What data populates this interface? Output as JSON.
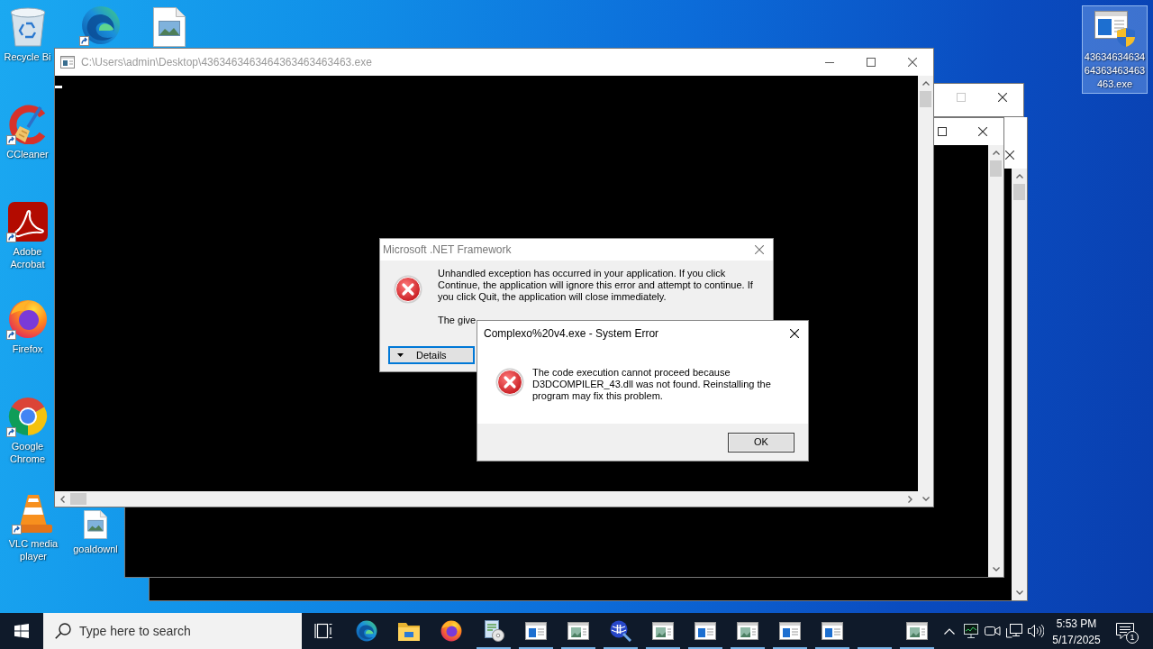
{
  "desktop_icons": [
    {
      "kind": "recycle-bin",
      "label": "Recycle Bi",
      "shortcut": false,
      "selected": false
    },
    {
      "kind": "edge",
      "shortcut": true,
      "selected": false
    },
    {
      "kind": "image-file",
      "shortcut": false,
      "selected": false
    },
    {
      "kind": "ccleaner",
      "label": "CCleaner",
      "shortcut": true,
      "selected": false
    },
    {
      "kind": "acrobat",
      "label": "Adobe Acrobat",
      "shortcut": true,
      "selected": false
    },
    {
      "kind": "firefox",
      "label": "Firefox",
      "shortcut": true,
      "selected": false
    },
    {
      "kind": "chrome",
      "label": "Google Chrome",
      "shortcut": true,
      "selected": false
    },
    {
      "kind": "vlc",
      "label": "VLC media player",
      "shortcut": true,
      "selected": false
    },
    {
      "kind": "image-file",
      "label": "goaldownl",
      "shortcut": false,
      "selected": false
    },
    {
      "kind": "program",
      "label": "4363463463464363463463463.exe",
      "shortcut": false,
      "selected": true
    }
  ],
  "background_windows": [
    {
      "kind": "blank",
      "maximize_disabled": true
    },
    {
      "kind": "console",
      "maximize_disabled": false
    },
    {
      "kind": "console"
    }
  ],
  "console_window": {
    "title": "C:\\Users\\admin\\Desktop\\4363463463464363463463463.exe",
    "active": false
  },
  "net_dialog": {
    "title": "Microsoft .NET Framework",
    "active": false,
    "message": "Unhandled exception has occurred in your application. If you click Continue, the application will ignore this error and attempt to continue. If you click Quit, the application will close immediately.",
    "detail": "The give",
    "buttons": [
      {
        "kind": "expander",
        "label": "Details",
        "focused": true
      }
    ]
  },
  "system_error_dialog": {
    "title": "Complexo%20v4.exe - System Error",
    "active": true,
    "message": "The code execution cannot proceed because D3DCOMPILER_43.dll was not found. Reinstalling the program may fix this problem.",
    "buttons": [
      {
        "label": "OK",
        "default": true
      }
    ]
  },
  "taskbar": {
    "search_placeholder": "Type here to search",
    "items": [
      {
        "kind": "task-view",
        "running": false
      },
      {
        "kind": "edge",
        "running": false
      },
      {
        "kind": "explorer",
        "running": false
      },
      {
        "kind": "firefox",
        "running": false
      },
      {
        "kind": "installer",
        "running": true
      },
      {
        "kind": "window-app",
        "running": true
      },
      {
        "kind": "window-picture",
        "running": true
      },
      {
        "kind": "tool",
        "running": true
      },
      {
        "kind": "window-picture",
        "running": true
      },
      {
        "kind": "window-app",
        "running": true
      },
      {
        "kind": "window-picture",
        "running": true
      },
      {
        "kind": "window-app",
        "running": true
      },
      {
        "kind": "window-app",
        "running": true
      },
      {
        "kind": "blank",
        "running": true
      },
      {
        "kind": "window-picture",
        "running": true
      }
    ],
    "tray": [
      {
        "kind": "chevron"
      },
      {
        "kind": "monitor"
      },
      {
        "kind": "camera"
      },
      {
        "kind": "network"
      },
      {
        "kind": "speaker"
      }
    ],
    "clock": {
      "time": "5:53 PM",
      "date": "5/17/2025"
    },
    "notification_count": "1"
  }
}
